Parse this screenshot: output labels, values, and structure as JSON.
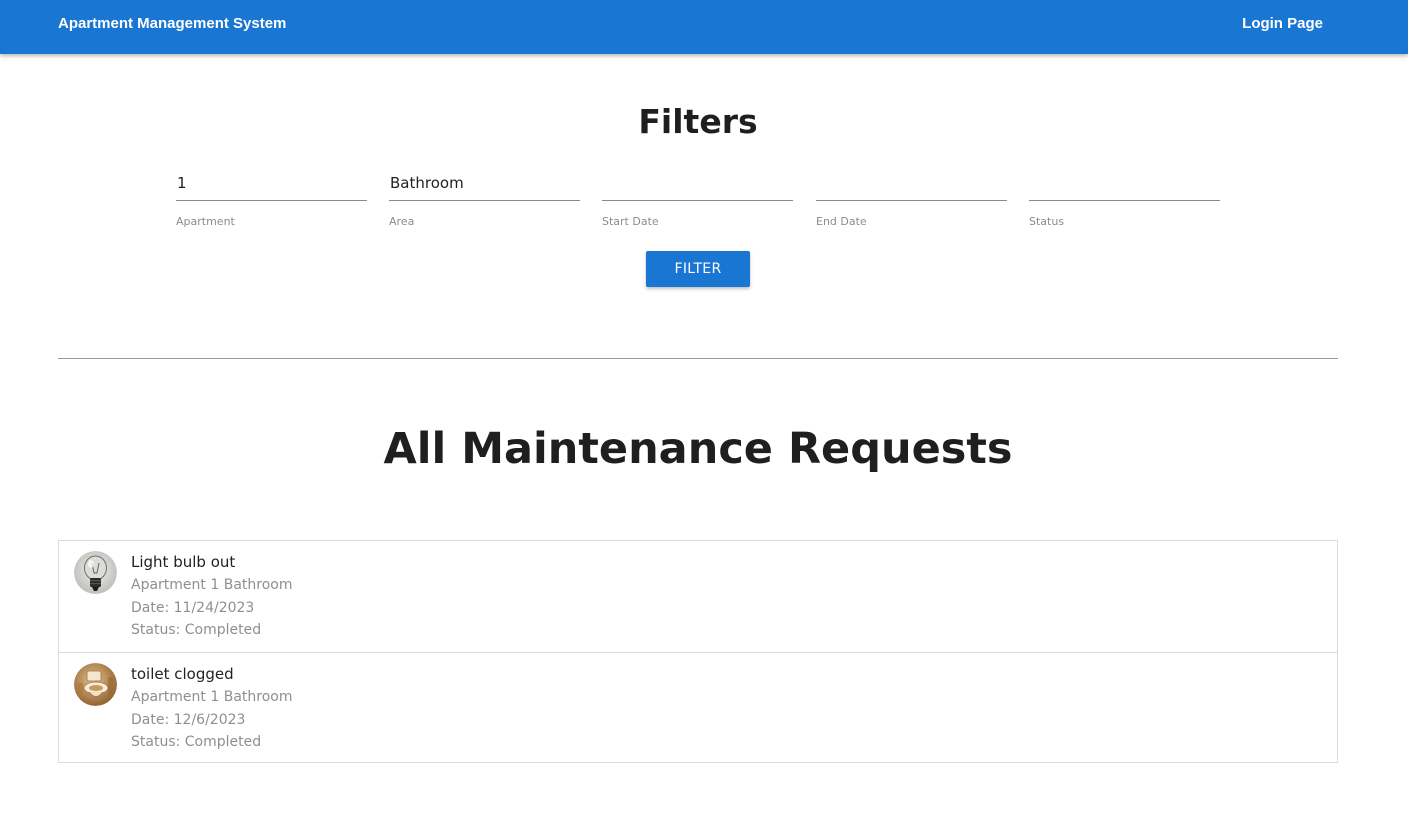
{
  "header": {
    "brand": "Apartment Management System",
    "login_link": "Login Page",
    "color": "#1976d2"
  },
  "filters": {
    "title": "Filters",
    "fields": [
      {
        "label": "Apartment",
        "value": "1"
      },
      {
        "label": "Area",
        "value": "Bathroom"
      },
      {
        "label": "Start Date",
        "value": ""
      },
      {
        "label": "End Date",
        "value": ""
      },
      {
        "label": "Status",
        "value": ""
      }
    ],
    "button_label": "FILTER"
  },
  "requests": {
    "title": "All Maintenance Requests",
    "items": [
      {
        "icon": "light-bulb-photo",
        "title": "Light bulb out",
        "location": "Apartment 1 Bathroom",
        "date": "Date: 11/24/2023",
        "status": "Status: Completed"
      },
      {
        "icon": "toilet-photo",
        "title": "toilet clogged",
        "location": "Apartment 1 Bathroom",
        "date": "Date: 12/6/2023",
        "status": "Status: Completed"
      }
    ]
  }
}
